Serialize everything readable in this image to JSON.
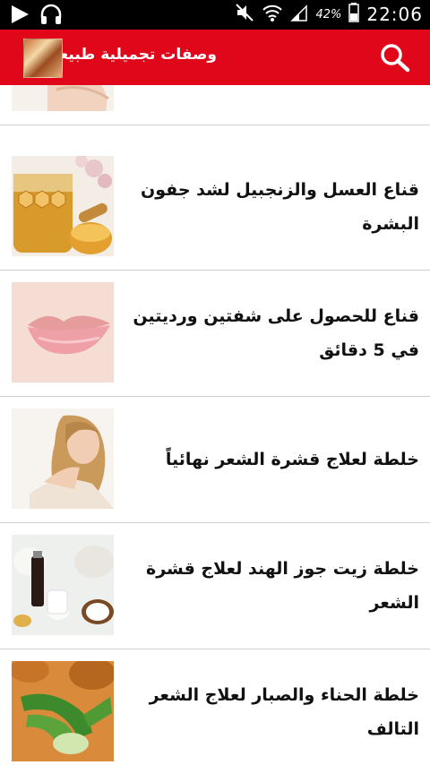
{
  "status_bar": {
    "battery_percent": "42%",
    "time": "22:06"
  },
  "app_bar": {
    "title": "وصفات تجميلية طبيعية"
  },
  "items": [
    {
      "title": "",
      "thumb": "feet"
    },
    {
      "title": "قناع العسل والزنجبيل لشد جفون البشرة",
      "thumb": "honey"
    },
    {
      "title": "قناع للحصول على شفتين ورديتين في 5 دقائق",
      "thumb": "lips"
    },
    {
      "title": "خلطة لعلاج قشرة الشعر نهائياً",
      "thumb": "woman-hair"
    },
    {
      "title": "خلطة زيت جوز الهند لعلاج قشرة الشعر",
      "thumb": "coconut-oil"
    },
    {
      "title": "خلطة الحناء والصبار لعلاج الشعر التالف",
      "thumb": "aloe-vera"
    }
  ],
  "colors": {
    "app_bar": "#e0071a",
    "status_bar": "#000000",
    "divider": "#cfcfcf"
  }
}
